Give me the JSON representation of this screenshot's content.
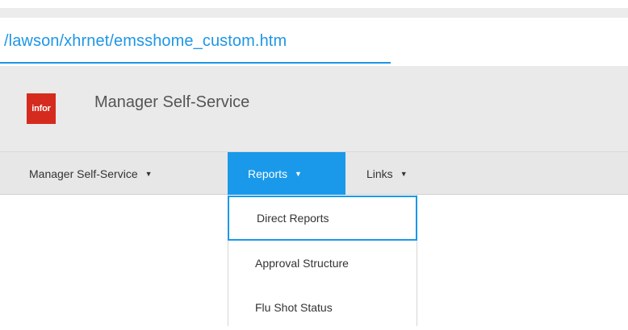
{
  "browser": {
    "url": "/lawson/xhrnet/emsshome_custom.htm"
  },
  "header": {
    "logo_text": "infor",
    "title": "Manager Self-Service",
    "brand_color": "#d52b1e"
  },
  "nav": {
    "items": [
      {
        "label": "Manager Self-Service",
        "icon": "caret-down-icon",
        "active": false
      },
      {
        "label": "Reports",
        "icon": "caret-down-icon",
        "active": true
      },
      {
        "label": "Links",
        "icon": "caret-down-icon",
        "active": false
      }
    ],
    "active_color": "#1a99ea"
  },
  "dropdown": {
    "items": [
      {
        "label": "Direct Reports",
        "focused": true
      },
      {
        "label": "Approval Structure",
        "focused": false
      },
      {
        "label": "Flu Shot Status",
        "focused": false
      }
    ]
  },
  "caret_glyph": "▼"
}
